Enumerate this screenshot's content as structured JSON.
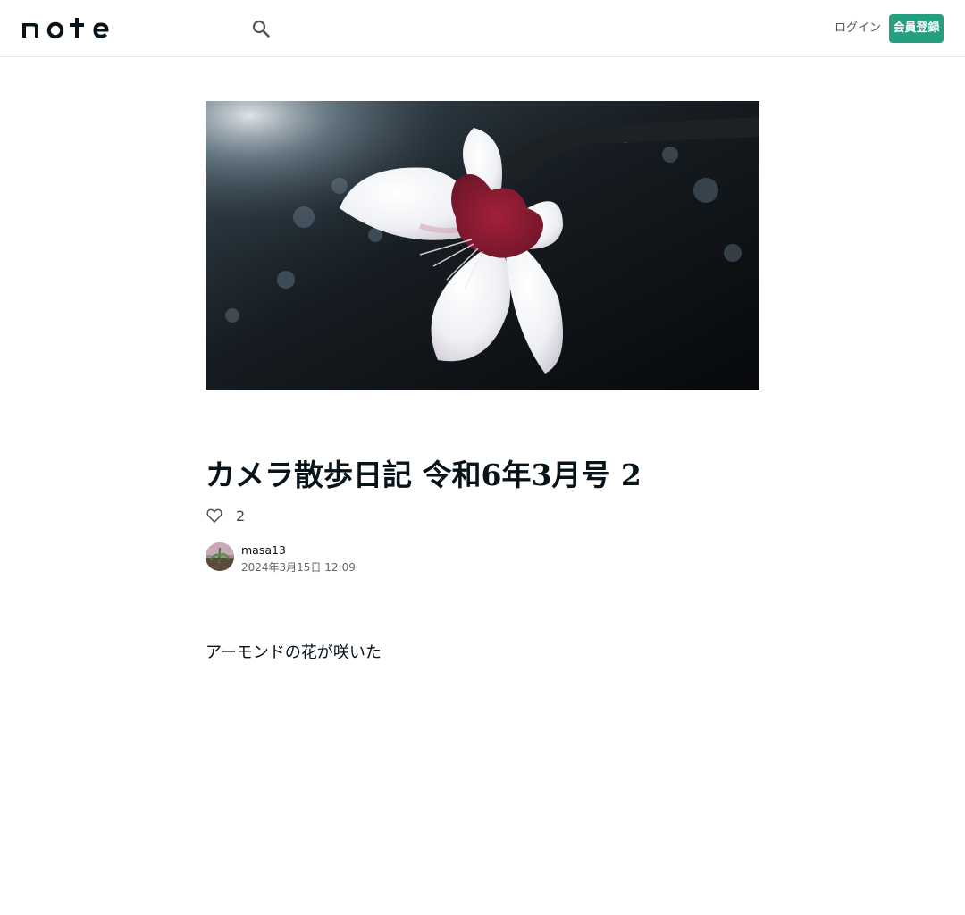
{
  "header": {
    "logo_text": "note",
    "login_label": "ログイン",
    "signup_label": "会員登録"
  },
  "article": {
    "title": "カメラ散歩日記 令和6年3月号 2",
    "like_count": "2",
    "author": {
      "name": "masa13",
      "date": "2024年3月15日 12:09"
    },
    "body": "アーモンドの花が咲いた"
  },
  "colors": {
    "accent": "#249f80",
    "text": "#08131a"
  },
  "icons": {
    "search": "search-icon",
    "heart": "heart-icon"
  }
}
